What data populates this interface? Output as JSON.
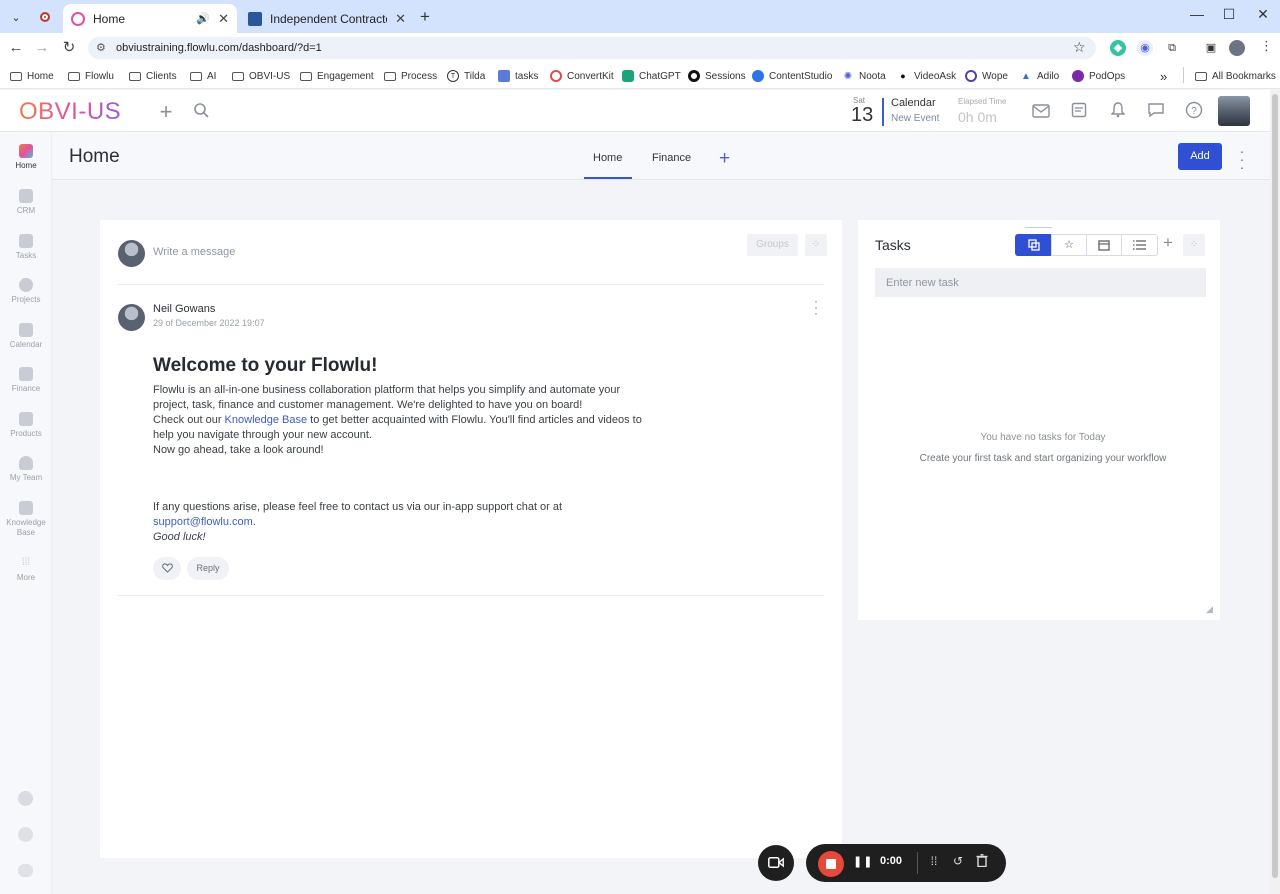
{
  "browser": {
    "tabs": [
      {
        "title": "Home"
      },
      {
        "title": "Independent Contractor Maste"
      }
    ],
    "url": "obviustraining.flowlu.com/dashboard/?d=1",
    "bookmarks": [
      "Home",
      "Flowlu",
      "Clients",
      "AI",
      "OBVI-US",
      "Engagement",
      "Process",
      "Tilda",
      "tasks",
      "ConvertKit",
      "ChatGPT",
      "Sessions",
      "ContentStudio",
      "Noota",
      "VideoAsk",
      "Wope",
      "Adilo",
      "PodOps"
    ],
    "all_bookmarks": "All Bookmarks",
    "overflow": "»"
  },
  "app": {
    "logo": "OBVI-US",
    "calendar": {
      "dow": "Sat",
      "day": "13",
      "title": "Calendar",
      "sub": "New Event"
    },
    "elapsed": {
      "label": "Elapsed Time",
      "value": "0h 0m"
    }
  },
  "sidebar": {
    "items": [
      {
        "label": "Home",
        "label2": ""
      },
      {
        "label": "CRM",
        "label2": ""
      },
      {
        "label": "Tasks",
        "label2": ""
      },
      {
        "label": "Projects",
        "label2": ""
      },
      {
        "label": "Calendar",
        "label2": ""
      },
      {
        "label": "Finance",
        "label2": ""
      },
      {
        "label": "Products",
        "label2": ""
      },
      {
        "label": "My Team",
        "label2": ""
      },
      {
        "label": "Knowledge",
        "label2": "Base"
      },
      {
        "label": "More",
        "label2": ""
      }
    ]
  },
  "page": {
    "title": "Home",
    "tabs": [
      "Home",
      "Finance"
    ],
    "add_label": "Add"
  },
  "feed": {
    "composer_placeholder": "Write a message",
    "groups_label": "Groups",
    "post": {
      "author": "Neil Gowans",
      "date": "29 of December 2022 19:07",
      "heading": "Welcome to your Flowlu!",
      "p1": "Flowlu is an all-in-one business collaboration platform that helps you simplify and automate your project, task, finance and customer management. We're delighted to have you on board!",
      "p2_before": "Check out our ",
      "p2_link": "Knowledge Base",
      "p2_after": " to get better acquainted with Flowlu. You'll find articles and videos to help you navigate through your new account.",
      "p3": "Now go ahead, take a look around!",
      "p4": "If any questions arise, please feel free to contact us via our in-app support chat or at",
      "email": "support@flowlu.com",
      "email_suffix": ".",
      "signoff": "Good luck!",
      "reply_label": "Reply"
    }
  },
  "tasks": {
    "title": "Tasks",
    "input_placeholder": "Enter new task",
    "empty_title": "You have no tasks for Today",
    "empty_sub": "Create your first task and start organizing your workflow"
  },
  "recorder": {
    "time": "0:00"
  }
}
